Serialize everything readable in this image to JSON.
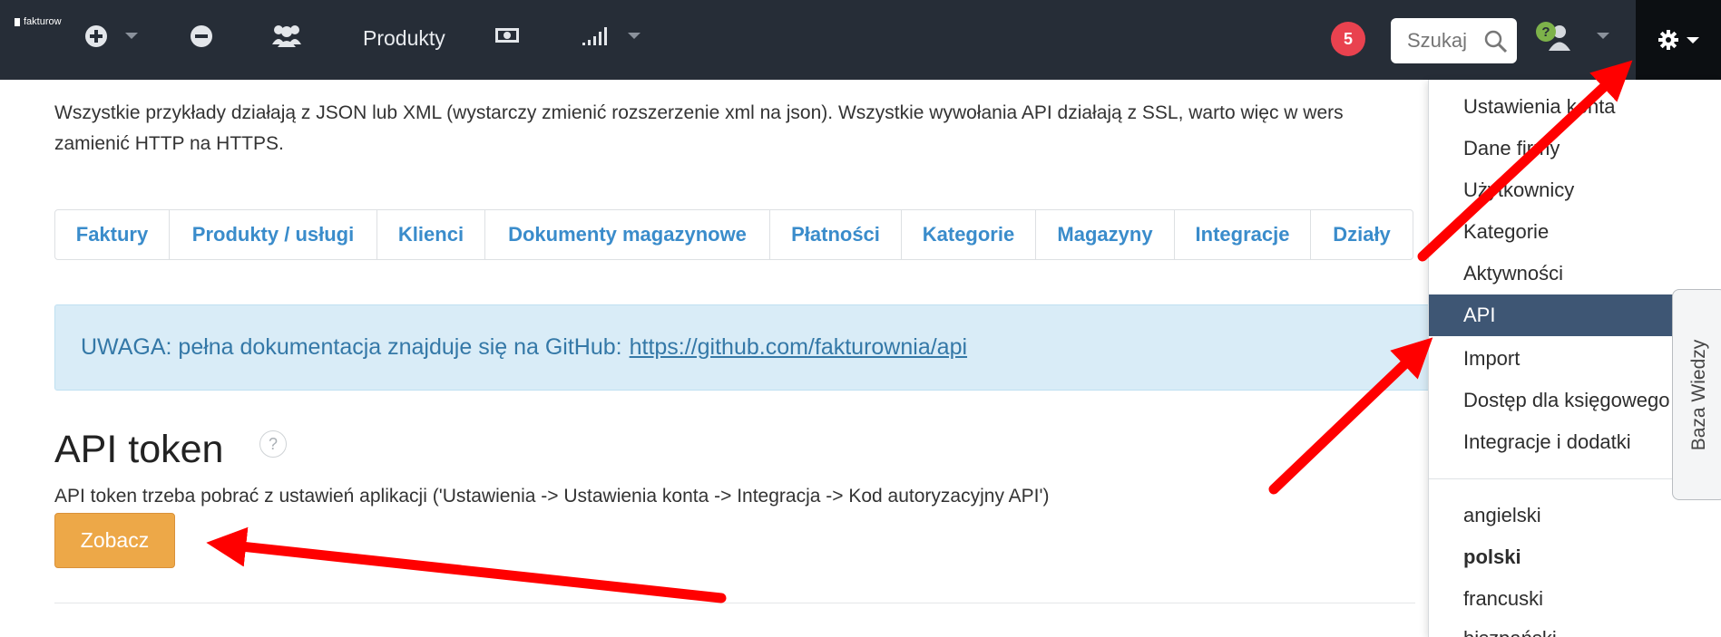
{
  "navbar": {
    "logo_text": "fakturow",
    "products_label": "Produkty",
    "notification_count": "5",
    "search_placeholder": "Szukaj"
  },
  "intro": {
    "line1": "Wszystkie przykłady działają z JSON lub XML (wystarczy zmienić rozszerzenie xml na json). Wszystkie wywołania API działają z SSL, warto więc w wers",
    "line2": "zamienić HTTP na HTTPS."
  },
  "tabs": [
    {
      "label": "Faktury"
    },
    {
      "label": "Produkty / usługi"
    },
    {
      "label": "Klienci"
    },
    {
      "label": "Dokumenty magazynowe"
    },
    {
      "label": "Płatności"
    },
    {
      "label": "Kategorie"
    },
    {
      "label": "Magazyny"
    },
    {
      "label": "Integracje"
    },
    {
      "label": "Działy"
    }
  ],
  "alert": {
    "prefix": "UWAGA: pełna dokumentacja znajduje się na GitHub:",
    "link": "https://github.com/fakturownia/api"
  },
  "token_section": {
    "title": "API token",
    "help": "?",
    "description": "API token trzeba pobrać z ustawień aplikacji ('Ustawienia -> Ustawienia konta -> Integracja -> Kod autoryzacyjny API')",
    "button": "Zobacz"
  },
  "settings_menu": {
    "items": [
      {
        "label": "Ustawienia konta"
      },
      {
        "label": "Dane firmy"
      },
      {
        "label": "Użytkownicy"
      },
      {
        "label": "Kategorie"
      },
      {
        "label": "Aktywności"
      },
      {
        "label": "API"
      },
      {
        "label": "Import"
      },
      {
        "label": "Dostęp dla księgowego"
      },
      {
        "label": "Integracje i dodatki"
      }
    ],
    "active_item": "API",
    "languages": [
      {
        "label": "angielski"
      },
      {
        "label": "polski"
      },
      {
        "label": "francuski"
      },
      {
        "label": "hiszpański"
      }
    ],
    "selected_language": "polski"
  },
  "side_tab": {
    "label": "Baza Wiedzy"
  },
  "colors": {
    "navbar": "#262d37",
    "link_blue": "#3a8ccb",
    "alert_bg": "#d9ecf7",
    "button_orange": "#eda848",
    "menu_active": "#3e5674",
    "annotation_red": "#ff0000",
    "badge_red": "#e9424f"
  },
  "icons": [
    "plus-circle-icon",
    "minus-circle-icon",
    "users-icon",
    "money-icon",
    "signal-bars-icon",
    "search-icon",
    "help-user-icon",
    "gear-icon"
  ]
}
